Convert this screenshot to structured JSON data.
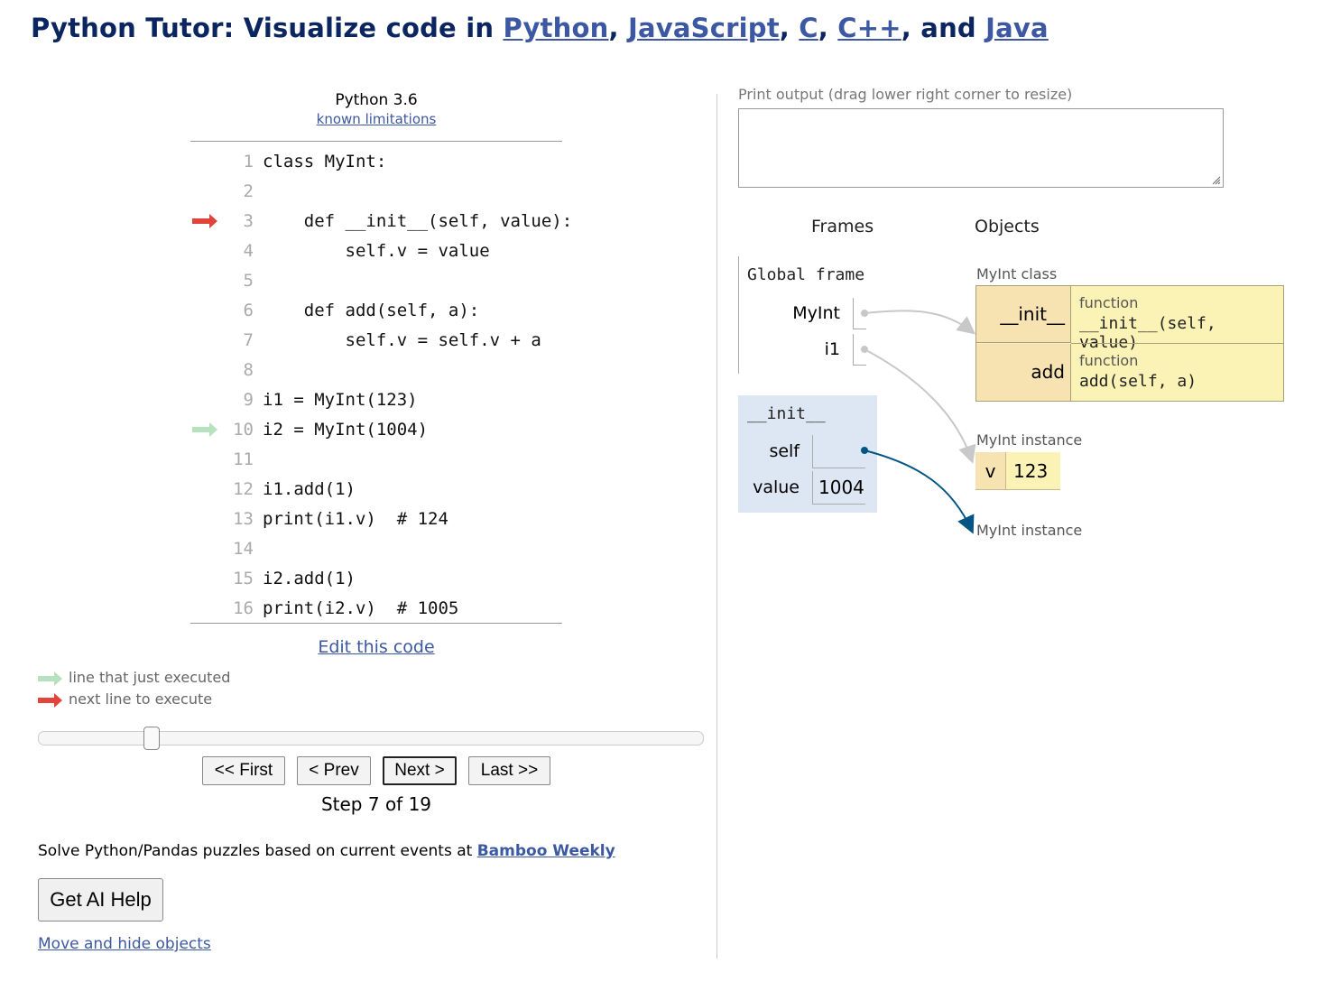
{
  "header": {
    "prefix": "Python Tutor: Visualize code in ",
    "langs": [
      "Python",
      "JavaScript",
      "C",
      "C++",
      "Java"
    ],
    "sep1": ", ",
    "sep2": ", ",
    "sep3": ", ",
    "sep4": ", and "
  },
  "editor": {
    "language": "Python 3.6",
    "limitations_link": "known limitations",
    "lines": [
      {
        "num": "1",
        "code": "class MyInt:"
      },
      {
        "num": "2",
        "code": ""
      },
      {
        "num": "3",
        "code": "    def __init__(self, value):"
      },
      {
        "num": "4",
        "code": "        self.v = value"
      },
      {
        "num": "5",
        "code": ""
      },
      {
        "num": "6",
        "code": "    def add(self, a):"
      },
      {
        "num": "7",
        "code": "        self.v = self.v + a"
      },
      {
        "num": "8",
        "code": ""
      },
      {
        "num": "9",
        "code": "i1 = MyInt(123)"
      },
      {
        "num": "10",
        "code": "i2 = MyInt(1004)"
      },
      {
        "num": "11",
        "code": ""
      },
      {
        "num": "12",
        "code": "i1.add(1)"
      },
      {
        "num": "13",
        "code": "print(i1.v)  # 124"
      },
      {
        "num": "14",
        "code": ""
      },
      {
        "num": "15",
        "code": "i2.add(1)"
      },
      {
        "num": "16",
        "code": "print(i2.v)  # 1005"
      }
    ],
    "next_line": 3,
    "just_executed_line": 10,
    "edit_link": "Edit this code"
  },
  "legend": {
    "just_executed": "line that just executed",
    "next_line": "next line to execute",
    "just_executed_color": "#b6e3bd",
    "next_line_color": "#e0443a"
  },
  "navigation": {
    "first": "<< First",
    "prev": "< Prev",
    "next": "Next >",
    "last": "Last >>",
    "step_text": "Step 7 of 19",
    "current_step": 7,
    "total_steps": 19
  },
  "footer": {
    "puzzles_text": "Solve Python/Pandas puzzles based on current events at ",
    "puzzles_link": "Bamboo Weekly",
    "ai_help": "Get AI Help",
    "move_hide": "Move and hide objects"
  },
  "output": {
    "label": "Print output (drag lower right corner to resize)",
    "content": ""
  },
  "visual": {
    "frames_header": "Frames",
    "objects_header": "Objects",
    "global_frame": {
      "name": "Global frame",
      "vars": [
        {
          "name": "MyInt"
        },
        {
          "name": "i1"
        }
      ]
    },
    "init_frame": {
      "name": "__init__",
      "vars": [
        {
          "name": "self",
          "value": ""
        },
        {
          "name": "value",
          "value": "1004"
        }
      ]
    },
    "class_obj": {
      "label": "MyInt class",
      "entries": [
        {
          "key": "__init__",
          "type": "function",
          "sig": "__init__(self, value)"
        },
        {
          "key": "add",
          "type": "function",
          "sig": "add(self, a)"
        }
      ]
    },
    "instance1": {
      "label": "MyInt instance",
      "key": "v",
      "value": "123"
    },
    "instance2": {
      "label": "MyInt instance"
    },
    "pointer_gray": "#c8c8c8",
    "pointer_active": "#005583",
    "class_bg": "#fbf3b6",
    "key_bg": "#f7e2b1",
    "frame_bg": "#dde6f3"
  }
}
